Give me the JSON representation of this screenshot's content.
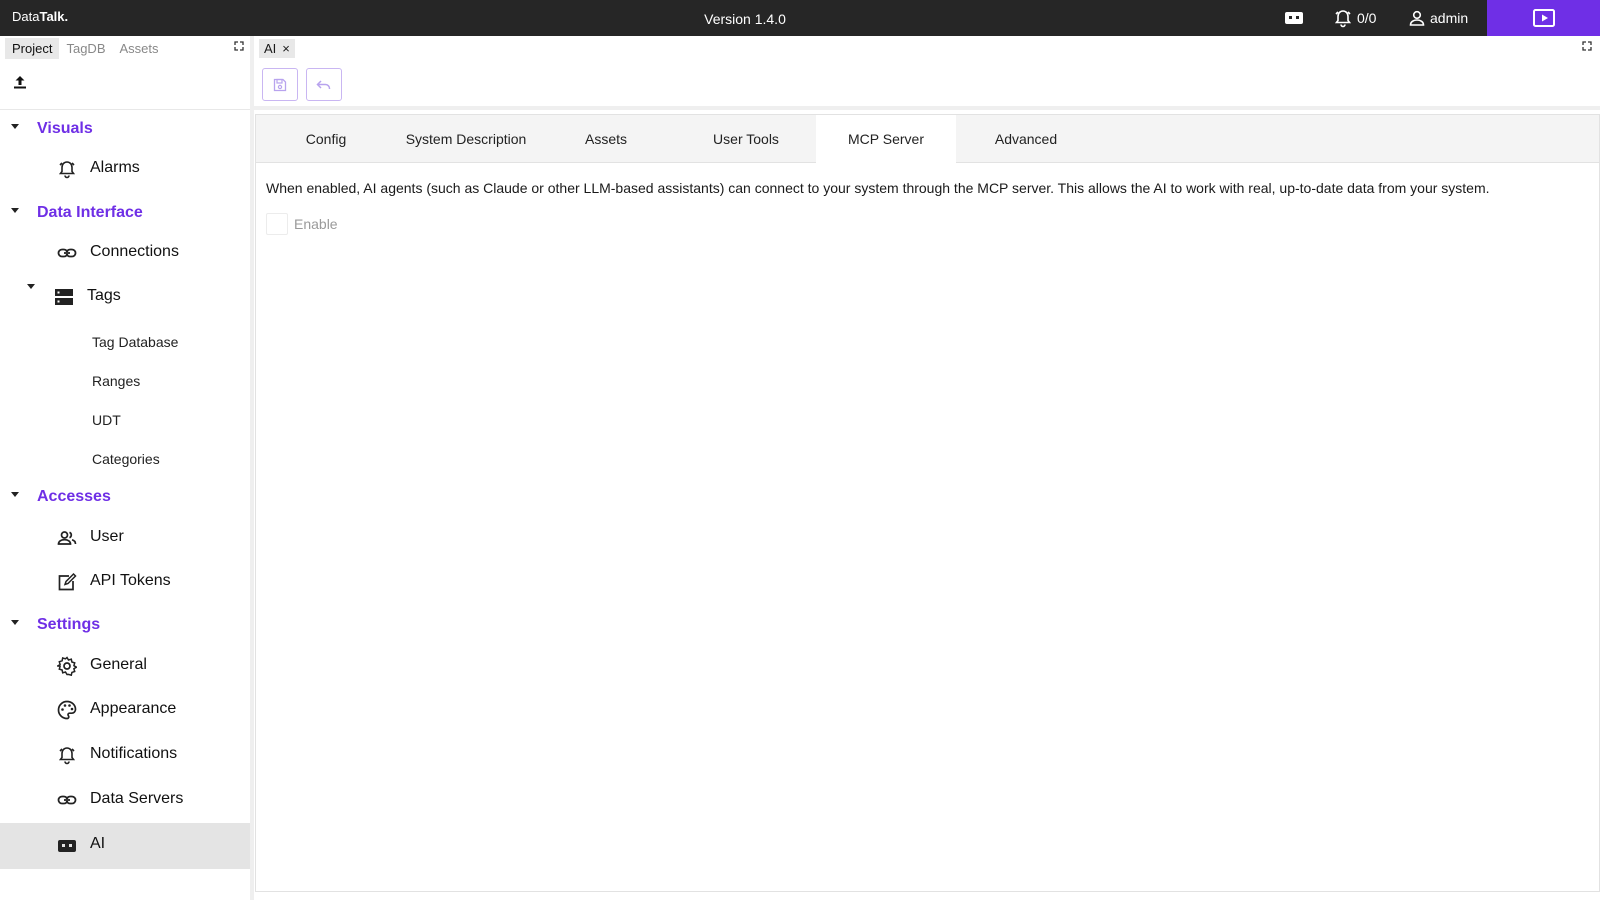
{
  "header": {
    "logo_plain": "Data",
    "logo_bold": "Talk.",
    "version": "Version 1.4.0",
    "alarm_count": "0/0",
    "user": "admin",
    "accent_color": "#6f2fe6"
  },
  "left_panel": {
    "tabs": [
      "Project",
      "TagDB",
      "Assets"
    ],
    "sections": [
      {
        "label": "Visuals",
        "items": [
          {
            "label": "Alarms",
            "icon": "alarm-bell-icon"
          }
        ]
      },
      {
        "label": "Data Interface",
        "items": [
          {
            "label": "Connections",
            "icon": "link-icon"
          },
          {
            "label": "Tags",
            "icon": "server-icon"
          }
        ]
      },
      {
        "label": "Accesses",
        "items": [
          {
            "label": "User",
            "icon": "users-icon"
          },
          {
            "label": "API Tokens",
            "icon": "token-edit-icon"
          }
        ]
      },
      {
        "label": "Settings",
        "items": [
          {
            "label": "General",
            "icon": "gear-icon"
          },
          {
            "label": "Appearance",
            "icon": "palette-icon"
          },
          {
            "label": "Notifications",
            "icon": "alarm-bell-icon"
          },
          {
            "label": "Data Servers",
            "icon": "link-icon"
          },
          {
            "label": "AI",
            "icon": "robot-icon"
          }
        ]
      }
    ],
    "tag_children": [
      "Tag Database",
      "Ranges",
      "UDT",
      "Categories"
    ]
  },
  "document": {
    "tab_label": "AI",
    "close_glyph": "×"
  },
  "ai_settings": {
    "tabs": [
      "Config",
      "System Description",
      "Assets",
      "User Tools",
      "MCP Server",
      "Advanced"
    ],
    "active_tab": "MCP Server",
    "description": "When enabled, AI agents (such as Claude or other LLM-based assistants) can connect to your system through the MCP server. This allows the AI to work with real, up-to-date data from your system.",
    "enable_label": "Enable",
    "enabled": false
  }
}
